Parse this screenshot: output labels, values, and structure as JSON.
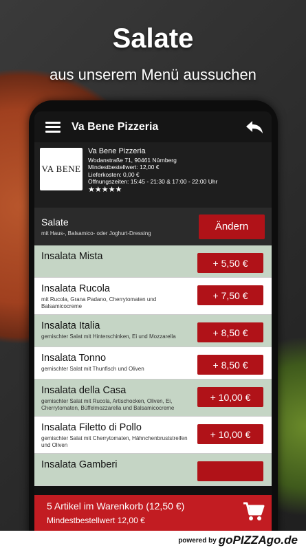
{
  "promo": {
    "headline": "Salate",
    "subheadline": "aus unserem Menü aussuchen"
  },
  "appbar": {
    "title": "Va Bene Pizzeria",
    "menu_icon": "hamburger-menu-icon",
    "back_icon": "back-arrow-icon"
  },
  "restaurant": {
    "logo_text": "VA BENE",
    "name": "Va Bene Pizzeria",
    "address": "Wodanstraße 71, 90461 Nürnberg",
    "min_order": "Mindestbestellwert: 12,00 €",
    "delivery": "Lieferkosten: 0,00 €",
    "hours": "Öffnungszeiten: 15:45 - 21:30 & 17:00 - 22:00 Uhr",
    "rating_stars": "★★★★★",
    "rating": 5
  },
  "category": {
    "title": "Salate",
    "description": "mit Haus-, Balsamico- oder Joghurt-Dressing",
    "change_label": "Ändern"
  },
  "items": [
    {
      "name": "Insalata Mista",
      "description": "",
      "price": "+ 5,50 €"
    },
    {
      "name": "Insalata Rucola",
      "description": "mit Rucola, Grana Padano, Cherrytomaten und Balsamicocreme",
      "price": "+ 7,50 €"
    },
    {
      "name": "Insalata Italia",
      "description": "gemischter Salat mit Hinterschinken, Ei und Mozzarella",
      "price": "+ 8,50 €"
    },
    {
      "name": "Insalata Tonno",
      "description": "gemischter Salat mit Thunfisch und Oliven",
      "price": "+ 8,50 €"
    },
    {
      "name": "Insalata della Casa",
      "description": "gemischter Salat mit Rucola, Artischocken, Oliven, Ei, Cherrytomaten, Büffelmozzarella und Balsamicocreme",
      "price": "+ 10,00 €"
    },
    {
      "name": "Insalata Filetto di Pollo",
      "description": "gemischter Salat mit Cherrytomaten, Hähnchenbruststreifen und Oliven",
      "price": "+ 10,00 €"
    },
    {
      "name": "Insalata Gamberi",
      "description": "",
      "price": ""
    }
  ],
  "cart": {
    "summary": "5 Artikel im Warenkorb (12,50 €)",
    "min_order": "Mindestbestellwert 12,00 €",
    "icon": "shopping-cart-icon"
  },
  "footer": {
    "powered_by": "powered by",
    "brand": "goPIZZAgo.de"
  },
  "colors": {
    "accent_red": "#b01218",
    "cart_red": "#c21c22",
    "row_green": "#c5d5c5"
  }
}
